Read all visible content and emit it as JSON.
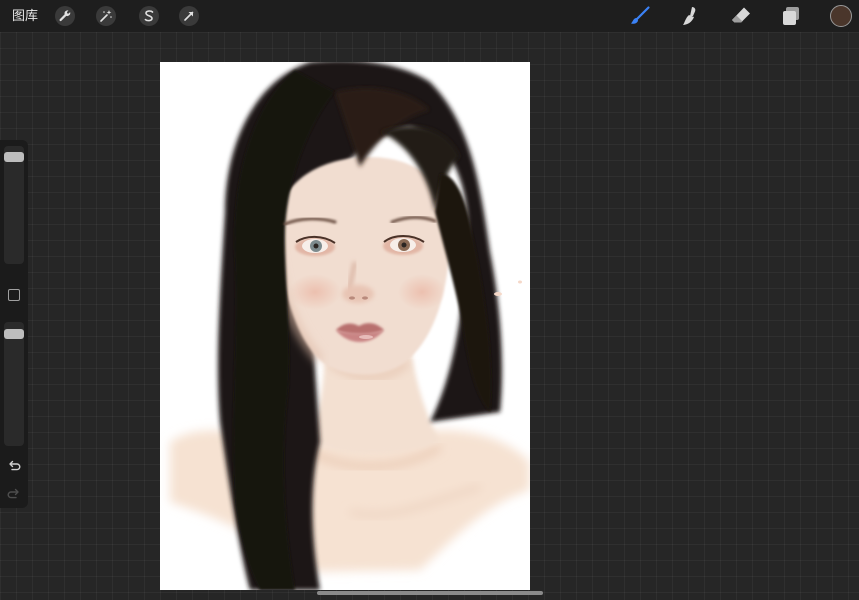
{
  "toolbar": {
    "gallery_label": "图库",
    "left_tools": [
      {
        "name": "actions-wrench-icon"
      },
      {
        "name": "adjustments-magic-wand-icon"
      },
      {
        "name": "selection-s-icon"
      },
      {
        "name": "transform-arrow-icon"
      }
    ],
    "right_tools": [
      {
        "name": "brush-icon",
        "active": true,
        "color": "#3b82f6"
      },
      {
        "name": "smudge-icon",
        "active": false
      },
      {
        "name": "eraser-icon",
        "active": false
      },
      {
        "name": "layers-icon",
        "active": false
      }
    ],
    "current_color": "#4a362b"
  },
  "sidebar": {
    "brush_size": 0.94,
    "opacity": 0.94
  },
  "canvas": {
    "background": "#ffffff",
    "artwork": "portrait-painting"
  }
}
